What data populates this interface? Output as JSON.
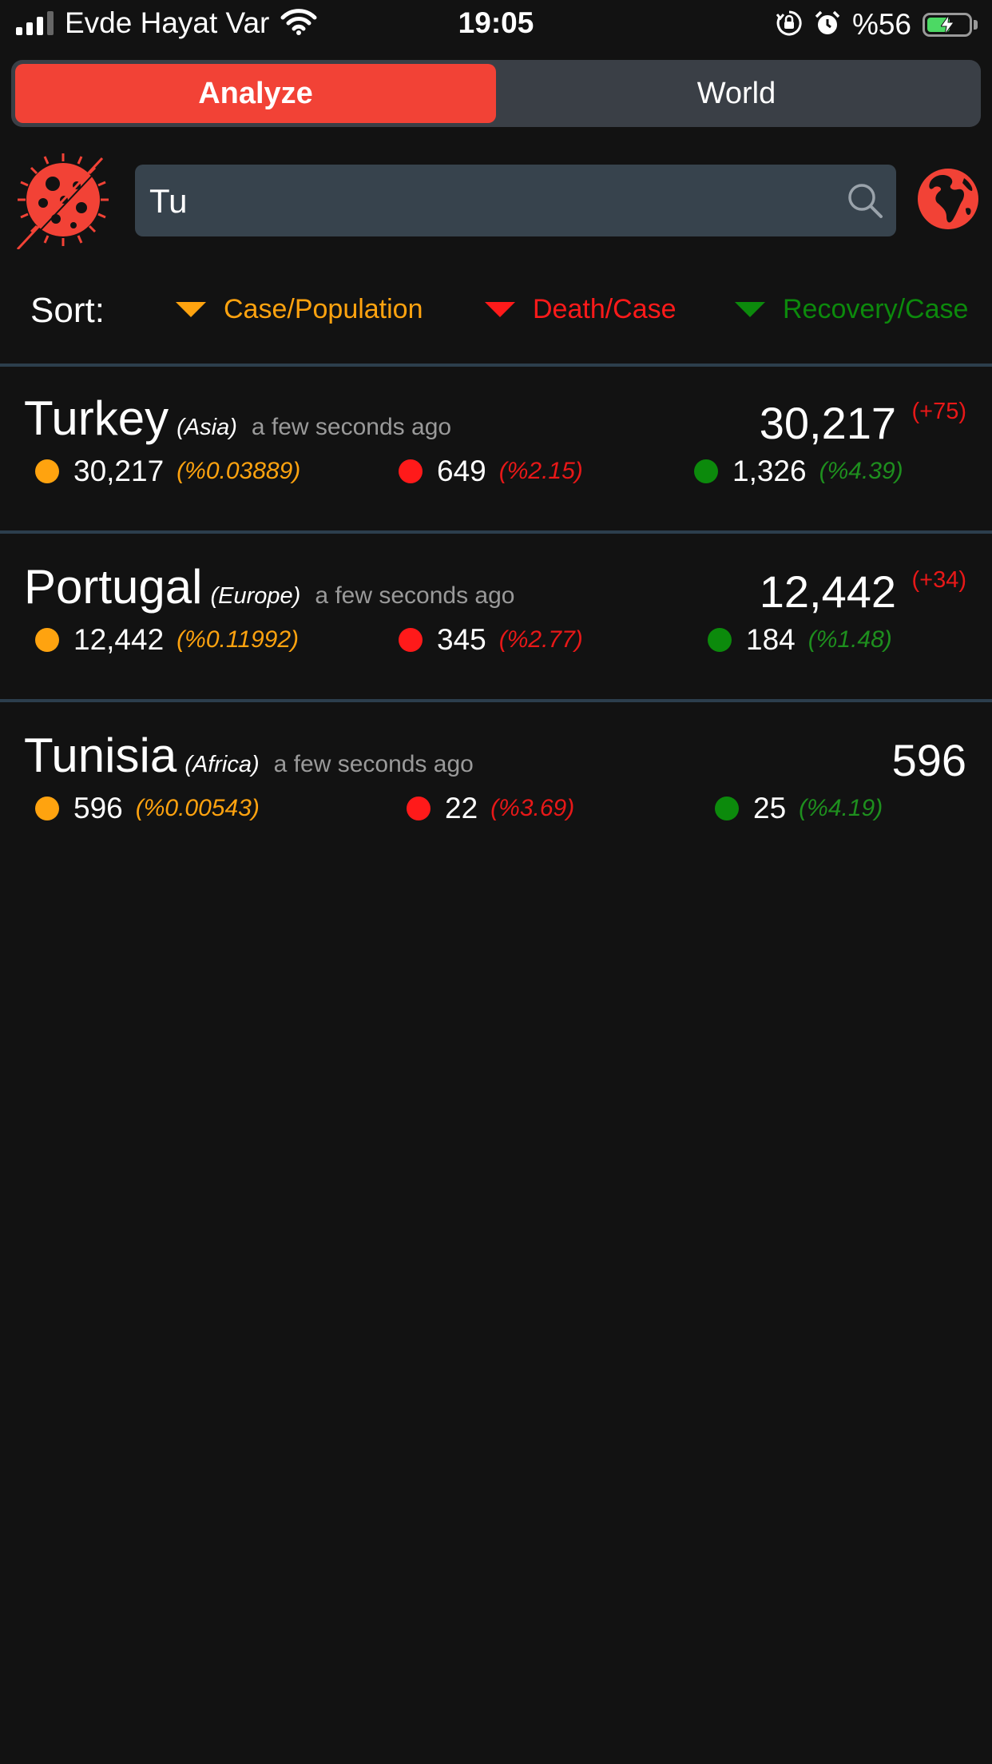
{
  "status_bar": {
    "carrier": "Evde Hayat Var",
    "time": "19:05",
    "battery_percent": "%56",
    "battery_level": 0.56,
    "icons": [
      "signal-icon",
      "wifi-icon",
      "orientation-lock-icon",
      "alarm-icon",
      "battery-charging-icon"
    ]
  },
  "tabs": [
    {
      "label": "Analyze",
      "active": true
    },
    {
      "label": "World",
      "active": false
    }
  ],
  "search": {
    "value": "Tu",
    "icon": "search-icon"
  },
  "header_icons": {
    "left": "virus-logo-icon",
    "right": "globe-icon"
  },
  "sort": {
    "label": "Sort:",
    "options": [
      {
        "label": "Case/Population",
        "color": "#ffa30f"
      },
      {
        "label": "Death/Case",
        "color": "#ff1a1a"
      },
      {
        "label": "Recovery/Case",
        "color": "#0c8a0c"
      }
    ]
  },
  "colors": {
    "accent": "#f24236",
    "cases": "#ffa30f",
    "deaths": "#ff1a1a",
    "deaths_pct": "#e81818",
    "recovered": "#0c8a0c",
    "recovered_pct": "#1e8f1e",
    "background": "#121212"
  },
  "countries": [
    {
      "name": "Turkey",
      "region": "(Asia)",
      "updated": "a few seconds ago",
      "total": "30,217",
      "delta": "(+75)",
      "cases": "30,217",
      "cases_pct": "(%0.03889)",
      "deaths": "649",
      "deaths_pct": "(%2.15)",
      "recovered": "1,326",
      "recovered_pct": "(%4.39)"
    },
    {
      "name": "Portugal",
      "region": "(Europe)",
      "updated": "a few seconds ago",
      "total": "12,442",
      "delta": "(+34)",
      "cases": "12,442",
      "cases_pct": "(%0.11992)",
      "deaths": "345",
      "deaths_pct": "(%2.77)",
      "recovered": "184",
      "recovered_pct": "(%1.48)"
    },
    {
      "name": "Tunisia",
      "region": "(Africa)",
      "updated": "a few seconds ago",
      "total": "596",
      "delta": "",
      "cases": "596",
      "cases_pct": "(%0.00543)",
      "deaths": "22",
      "deaths_pct": "(%3.69)",
      "recovered": "25",
      "recovered_pct": "(%4.19)"
    }
  ]
}
